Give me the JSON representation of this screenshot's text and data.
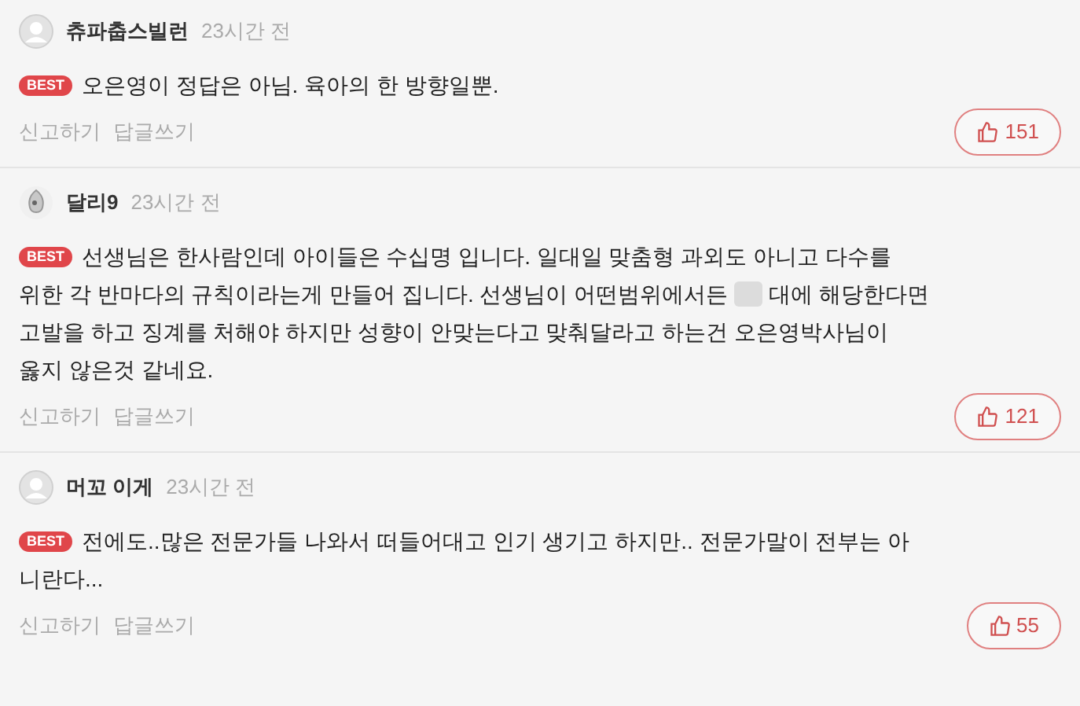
{
  "comments": [
    {
      "author": "츄파춥스빌런",
      "time": "23시간 전",
      "avatar": {
        "kind": "default"
      },
      "badge": "BEST",
      "lines": [
        [
          {
            "kind": "text",
            "text": "오은영이 정답은 아님. 육아의 한 방향일뿐."
          }
        ]
      ],
      "actions": [
        "신고하기",
        "답글쓰기"
      ],
      "likes": "151"
    },
    {
      "author": "달리9",
      "time": "23시간 전",
      "avatar": {
        "kind": "custom"
      },
      "badge": "BEST",
      "lines": [
        [
          {
            "kind": "text",
            "text": "선생님은 한사람인데 아이들은 수십명 입니다. 일대일 맞춤형 과외도 아니고 다수를"
          }
        ],
        [
          {
            "kind": "text",
            "text": "위한 각 반마다의 규칙이라는게 만들어 집니다. 선생님이 어떤범위에서든"
          },
          {
            "kind": "blur"
          },
          {
            "kind": "text",
            "text": "대에 해당한다면"
          }
        ],
        [
          {
            "kind": "text",
            "text": "고발을 하고 징계를 처해야 하지만 성향이 안맞는다고 맞춰달라고 하는건 오은영박사님이"
          }
        ],
        [
          {
            "kind": "text",
            "text": "옳지 않은것 같네요."
          }
        ]
      ],
      "actions": [
        "신고하기",
        "답글쓰기"
      ],
      "likes": "121"
    },
    {
      "author": "머꼬 이게",
      "time": "23시간 전",
      "avatar": {
        "kind": "default"
      },
      "badge": "BEST",
      "lines": [
        [
          {
            "kind": "text",
            "text": "전에도..많은 전문가들 나와서 떠들어대고 인기 생기고 하지만.. 전문가말이 전부는 아"
          }
        ],
        [
          {
            "kind": "text",
            "text": "니란다..."
          }
        ]
      ],
      "actions": [
        "신고하기",
        "답글쓰기"
      ],
      "likes": "55"
    }
  ]
}
